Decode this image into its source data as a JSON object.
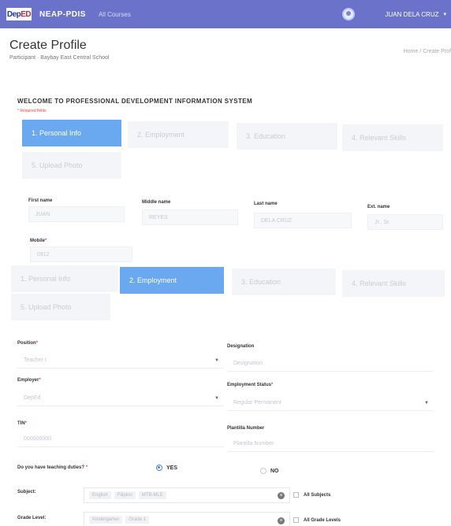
{
  "topbar": {
    "logo_dep": "Dep",
    "logo_ed": "ED",
    "app_name": "NEAP-PDIS",
    "nav_courses": "All Courses",
    "user_name": "JUAN DELA CRUZ",
    "caret": "▾"
  },
  "header": {
    "title": "Create Profile",
    "subtitle": "Participant · Baybay East Central School",
    "breadcrumb": "Home / Create Prof"
  },
  "welcome": {
    "heading": "WELCOME TO PROFESSIONAL DEVELOPMENT INFORMATION SYSTEM",
    "required_note": "* Required fields"
  },
  "steps_top": [
    {
      "label": "1. Personal Info",
      "active": true
    },
    {
      "label": "2. Employment",
      "active": false
    },
    {
      "label": "3. Education",
      "active": false
    },
    {
      "label": "4. Relevant Skills",
      "active": false
    },
    {
      "label": "5. Upload Photo",
      "active": false
    }
  ],
  "personal": {
    "first_name_label": "First name",
    "first_name_value": "JUAN",
    "middle_name_label": "Middle name",
    "middle_name_value": "REYES",
    "last_name_label": "Last name",
    "last_name_value": "DELA CRUZ",
    "ext_name_label": "Ext. name",
    "ext_name_value": "Jr., Sr.",
    "mobile_label": "Mobile",
    "mobile_value": "0912"
  },
  "steps_second": [
    {
      "label": "1. Personal Info",
      "active": false
    },
    {
      "label": "2. Employment",
      "active": true
    },
    {
      "label": "3. Education",
      "active": false
    },
    {
      "label": "4. Relevant Skills",
      "active": false
    },
    {
      "label": "5. Upload Photo",
      "active": false
    }
  ],
  "employment": {
    "position_label": "Position",
    "position_value": "Teacher I",
    "designation_label": "Designation",
    "designation_placeholder": "Designation",
    "employer_label": "Employer",
    "employer_value": "DepEd",
    "status_label": "Employment Status",
    "status_value": "Regular Permanent",
    "tin_label": "TIN",
    "tin_placeholder": "000000000",
    "plantilla_label": "Plantilla Number",
    "plantilla_placeholder": "Plantilla Number",
    "teaching_question": "Do you have teaching duties?",
    "yes_label": "YES",
    "no_label": "NO",
    "subject_label": "Subject:",
    "subject_tags": [
      "English",
      "Filipino",
      "MTB-MLE"
    ],
    "all_subjects_label": "All Subjects",
    "grade_label": "Grade Level:",
    "grade_tags": [
      "Kindergarten",
      "Grade 1"
    ],
    "all_grades_label": "All Grade Levels"
  },
  "colors": {
    "topbar": "#6a73c9",
    "active_step": "#6aa9f0",
    "required": "#e44444"
  }
}
